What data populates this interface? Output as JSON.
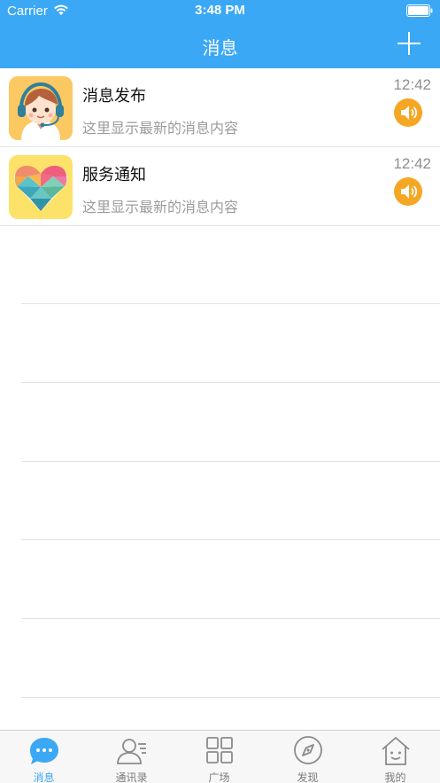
{
  "status_bar": {
    "carrier": "Carrier",
    "time": "3:48 PM"
  },
  "nav": {
    "title": "消息",
    "add_icon": "plus-icon"
  },
  "messages": [
    {
      "title": "消息发布",
      "preview": "这里显示最新的消息内容",
      "time": "12:42",
      "avatar": "customer-service-avatar",
      "status_icon": "speaker-icon"
    },
    {
      "title": "服务通知",
      "preview": "这里显示最新的消息内容",
      "time": "12:42",
      "avatar": "heart-avatar",
      "status_icon": "speaker-icon"
    }
  ],
  "tabs": [
    {
      "label": "消息",
      "icon": "chat-bubble-icon",
      "active": true
    },
    {
      "label": "通讯录",
      "icon": "contacts-icon",
      "active": false
    },
    {
      "label": "广场",
      "icon": "grid-icon",
      "active": false
    },
    {
      "label": "发现",
      "icon": "compass-icon",
      "active": false
    },
    {
      "label": "我的",
      "icon": "house-icon",
      "active": false
    }
  ],
  "colors": {
    "primary": "#3aa8f5",
    "accent_orange": "#f5a623",
    "tab_inactive": "#7b7b7b",
    "divider": "#e2e2e2"
  }
}
